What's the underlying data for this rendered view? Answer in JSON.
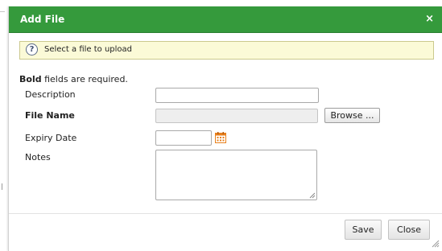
{
  "dialog": {
    "title": "Add File",
    "close_glyph": "×",
    "header_color": "#359a3c"
  },
  "info": {
    "icon": "info-help-icon",
    "icon_glyph": "?",
    "message": "Select a file to upload"
  },
  "required_note": {
    "bold_word": "Bold",
    "rest": " fields are required."
  },
  "form": {
    "description_label": "Description",
    "description_value": "",
    "filename_label": "File Name",
    "filename_value": "",
    "browse_label": "Browse ...",
    "expiry_label": "Expiry Date",
    "expiry_value": "",
    "calendar_icon": "calendar-icon",
    "calendar_color": "#e8801c",
    "notes_label": "Notes",
    "notes_value": ""
  },
  "buttons": {
    "save_label": "Save",
    "close_label": "Close"
  }
}
